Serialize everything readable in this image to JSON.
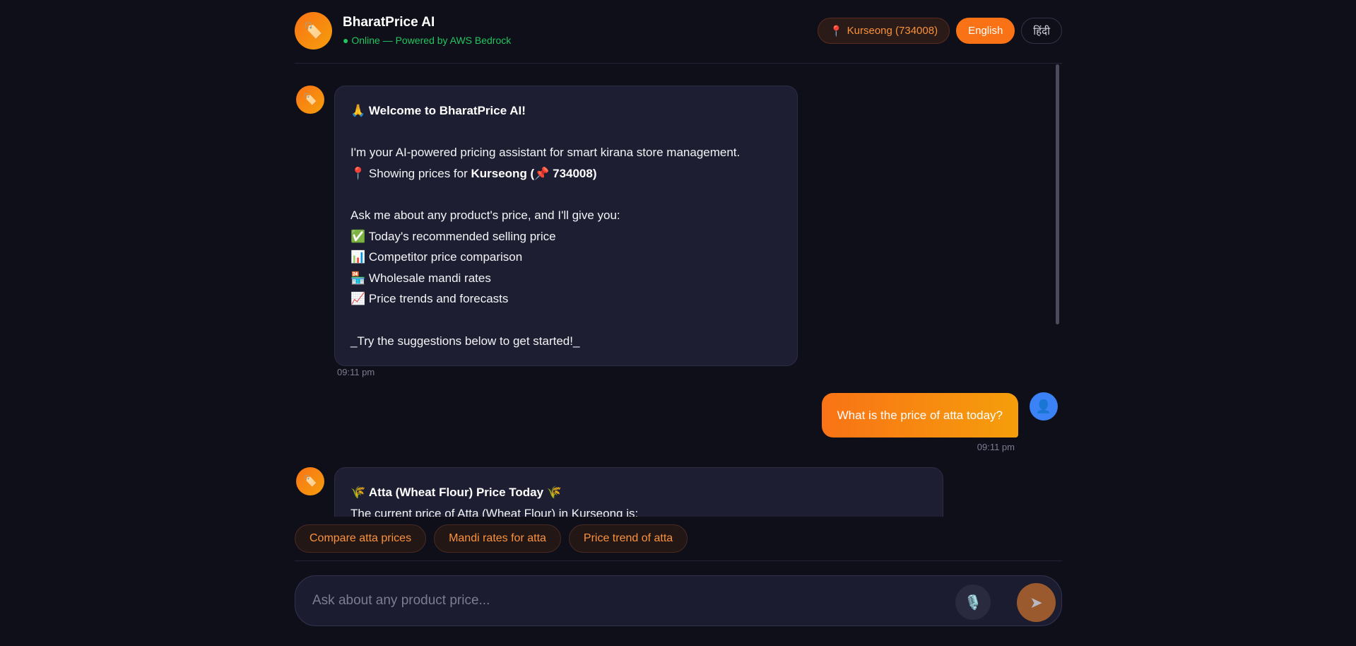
{
  "header": {
    "logo_icon": "🏷️",
    "title": "BharatPrice AI",
    "status": "● Online — Powered by AWS Bedrock",
    "location_icon": "📍",
    "location": "Kurseong (734008)",
    "lang_english": "English",
    "lang_hindi": "हिंदी"
  },
  "messages": {
    "bot_icon": "🏷️",
    "user_icon": "👤",
    "welcome": {
      "title_icon": "🙏",
      "title": "Welcome to BharatPrice AI!",
      "intro": "I'm your AI-powered pricing assistant for smart kirana store management.",
      "showing_icon": "📍",
      "showing_prefix": "Showing prices for ",
      "showing_place": "Kurseong (",
      "pin_icon": "📌",
      "showing_pin": " 734008)",
      "ask": "Ask me about any product's price, and I'll give you:",
      "features": [
        {
          "icon": "✅",
          "text": "Today's recommended selling price"
        },
        {
          "icon": "📊",
          "text": "Competitor price comparison"
        },
        {
          "icon": "🏪",
          "text": "Wholesale mandi rates"
        },
        {
          "icon": "📈",
          "text": "Price trends and forecasts"
        }
      ],
      "footer": "_Try the suggestions below to get started!_",
      "time": "09:11 pm"
    },
    "user": {
      "text": "What is the price of atta today?",
      "time": "09:11 pm"
    },
    "answer": {
      "title_icon": "🌾",
      "title": "Atta (Wheat Flour) Price Today",
      "line1": "The current price of Atta (Wheat Flour) in Kurseong is:"
    }
  },
  "suggestions": [
    "Compare atta prices",
    "Mandi rates for atta",
    "Price trend of atta"
  ],
  "input": {
    "placeholder": "Ask about any product price...",
    "mic_icon": "🎙️",
    "send_icon": "➤"
  },
  "colors": {
    "accent": "#f97316",
    "background": "#0f0f1a",
    "online": "#22c55e",
    "user_avatar": "#3b82f6"
  }
}
